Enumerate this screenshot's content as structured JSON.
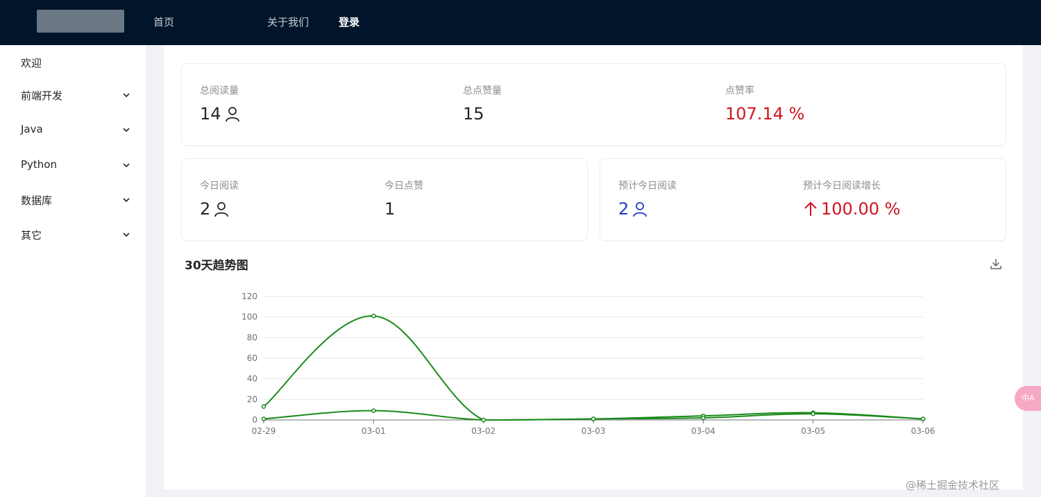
{
  "header": {
    "nav": [
      {
        "label": "首页",
        "active": false
      },
      {
        "label": "关于我们",
        "active": false
      },
      {
        "label": "登录",
        "active": true
      }
    ]
  },
  "sidebar": {
    "items": [
      {
        "label": "欢迎",
        "expandable": false
      },
      {
        "label": "前端开发",
        "expandable": true
      },
      {
        "label": "Java",
        "expandable": true
      },
      {
        "label": "Python",
        "expandable": true
      },
      {
        "label": "数据库",
        "expandable": true
      },
      {
        "label": "其它",
        "expandable": true
      }
    ]
  },
  "stats": {
    "total_reads": {
      "title": "总阅读量",
      "value": "14"
    },
    "total_likes": {
      "title": "总点赞量",
      "value": "15"
    },
    "like_rate": {
      "title": "点赞率",
      "value": "107.14 %"
    },
    "today_reads": {
      "title": "今日阅读",
      "value": "2"
    },
    "today_likes": {
      "title": "今日点赞",
      "value": "1"
    },
    "est_today_reads": {
      "title": "预计今日阅读",
      "value": "2"
    },
    "est_growth": {
      "title": "预计今日阅读增长",
      "value": "100.00 %"
    }
  },
  "chart_section": {
    "title": "30天趋势图"
  },
  "colors": {
    "red": "#cf1322",
    "blue": "#1d39c4",
    "line": "#1a8a1a",
    "header_bg": "#001529"
  },
  "chart_data": {
    "type": "line",
    "x": [
      "02-29",
      "03-01",
      "03-02",
      "03-03",
      "03-04",
      "03-05",
      "03-06"
    ],
    "yticks": [
      0,
      20,
      40,
      60,
      80,
      100,
      120
    ],
    "ylim": [
      0,
      120
    ],
    "series": [
      {
        "values": [
          13,
          101,
          0,
          1,
          4,
          7,
          1
        ]
      },
      {
        "values": [
          1,
          9,
          0,
          1,
          2,
          6,
          1
        ]
      }
    ],
    "grid": true,
    "smooth": true
  },
  "floating_button": {
    "label": "中A"
  },
  "watermark": {
    "text": "@稀土掘金技术社区"
  }
}
